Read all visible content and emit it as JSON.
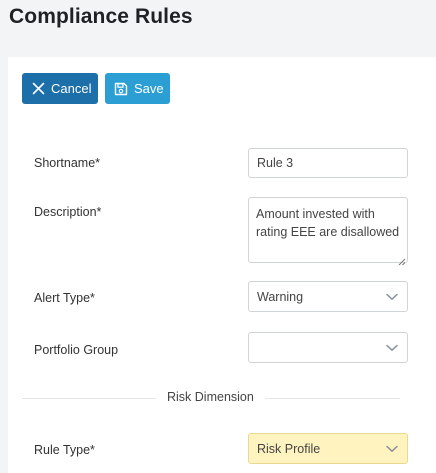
{
  "page": {
    "title": "Compliance Rules"
  },
  "toolbar": {
    "cancel_label": "Cancel",
    "save_label": "Save",
    "cancel_icon": "close-icon",
    "save_icon": "save-icon"
  },
  "form": {
    "shortname": {
      "label": "Shortname*",
      "value": "Rule 3"
    },
    "description": {
      "label": "Description*",
      "value": "Amount invested with rating EEE are disallowed"
    },
    "alert_type": {
      "label": "Alert Type*",
      "value": "Warning"
    },
    "portfolio_group": {
      "label": "Portfolio Group",
      "value": ""
    },
    "section_risk": {
      "label": "Risk Dimension"
    },
    "rule_type": {
      "label": "Rule Type*",
      "value": "Risk Profile"
    }
  },
  "colors": {
    "cancel_button": "#1c6fa8",
    "save_button": "#2b9fd4",
    "highlight_select": "#fff3bf"
  }
}
